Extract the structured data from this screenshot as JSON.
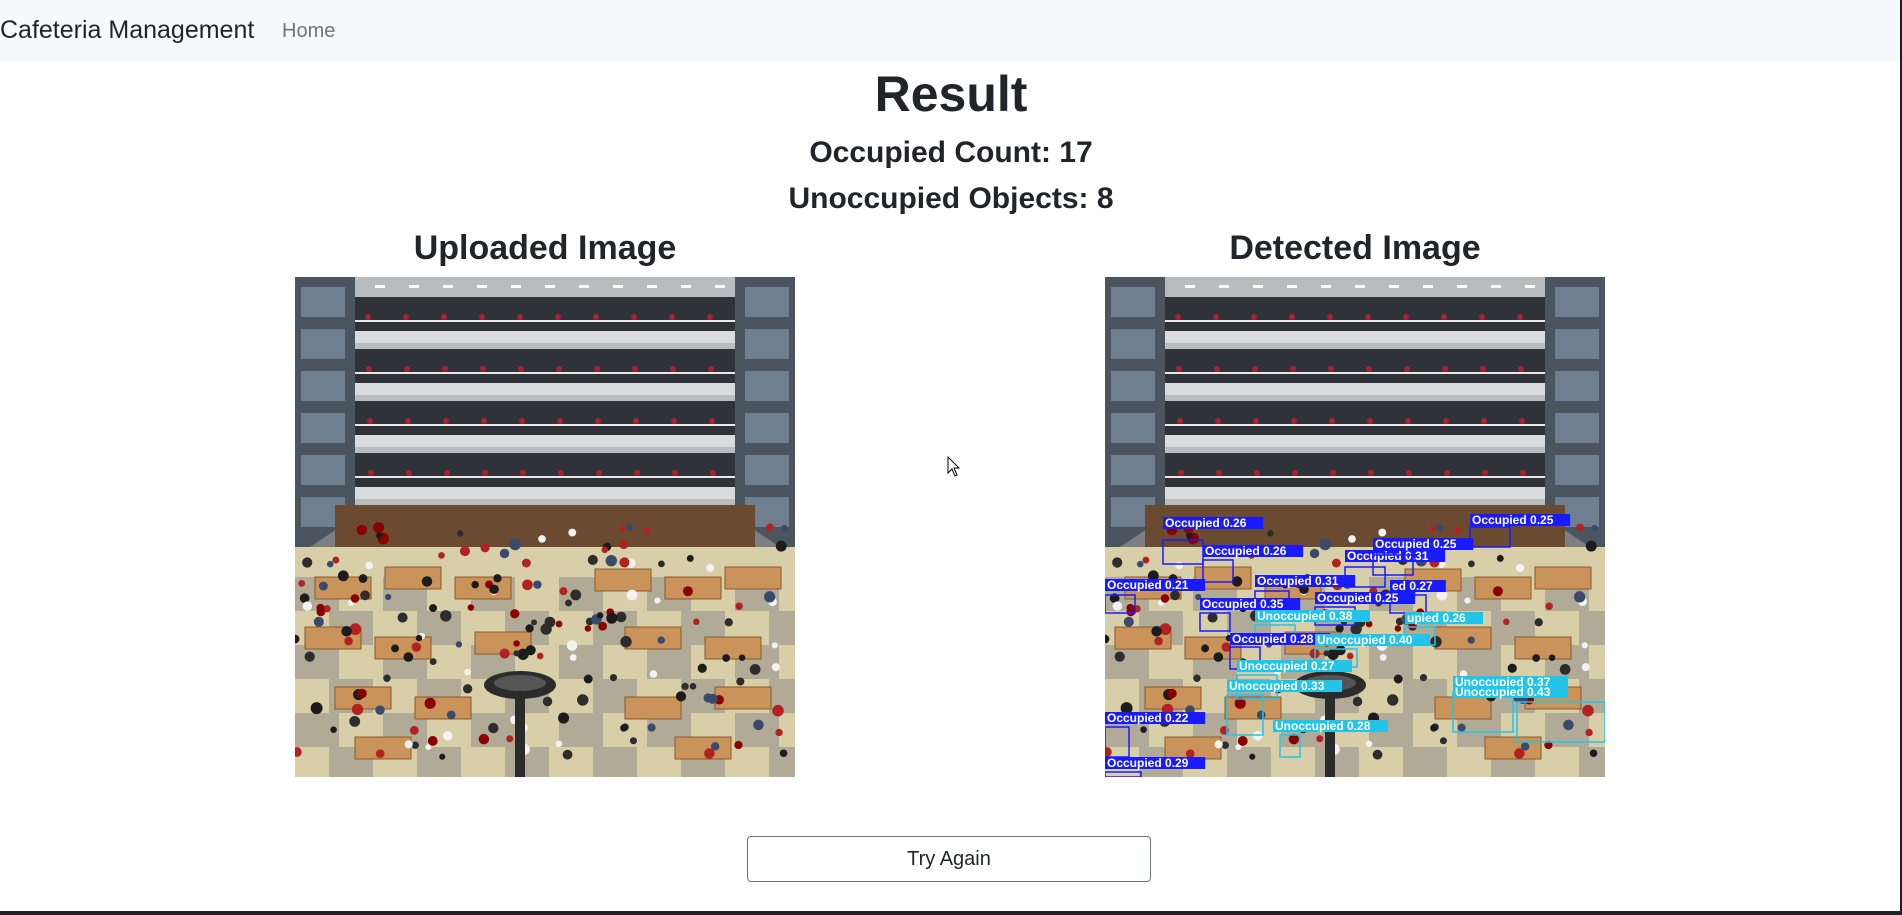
{
  "navbar": {
    "brand": "Cafeteria Management",
    "links": [
      {
        "label": "Home"
      }
    ]
  },
  "result": {
    "title": "Result",
    "occupied_count": "Occupied Count: 17",
    "unoccupied_objects": "Unoccupied Objects: 8"
  },
  "images": {
    "uploaded_heading": "Uploaded Image",
    "detected_heading": "Detected Image"
  },
  "detections": [
    {
      "label": "Occupied 0.26",
      "cls": "occupied"
    },
    {
      "label": "Occupied 0.26",
      "cls": "occupied"
    },
    {
      "label": "Occupied 0.31",
      "cls": "occupied"
    },
    {
      "label": "Occupied 0.25",
      "cls": "occupied"
    },
    {
      "label": "Occupied 0.25",
      "cls": "occupied"
    },
    {
      "label": "Occupied 0.21",
      "cls": "occupied"
    },
    {
      "label": "Occupied 0.31",
      "cls": "occupied"
    },
    {
      "label": "ed 0.27",
      "cls": "occupied"
    },
    {
      "label": "Occupied 0.25",
      "cls": "occupied"
    },
    {
      "label": "Occupied 0.35",
      "cls": "occupied"
    },
    {
      "label": "Unoccupied 0.38",
      "cls": "unoccupied"
    },
    {
      "label": "upied 0.26",
      "cls": "unoccupied"
    },
    {
      "label": "Occupied 0.28",
      "cls": "occupied"
    },
    {
      "label": "Unoccupied 0.40",
      "cls": "unoccupied"
    },
    {
      "label": "Unoccupied 0.27",
      "cls": "unoccupied"
    },
    {
      "label": "Unoccupied 0.33",
      "cls": "unoccupied"
    },
    {
      "label": "Unoccupied 0.37",
      "cls": "unoccupied"
    },
    {
      "label": "Unoccupied 0.43",
      "cls": "unoccupied"
    },
    {
      "label": "Occupied 0.22",
      "cls": "occupied"
    },
    {
      "label": "Unoccupied 0.28",
      "cls": "unoccupied"
    },
    {
      "label": "Occupied 0.29",
      "cls": "occupied"
    }
  ],
  "actions": {
    "try_again": "Try Again"
  },
  "colors": {
    "occupied": "#1a1aff",
    "unoccupied": "#22c4e8"
  }
}
